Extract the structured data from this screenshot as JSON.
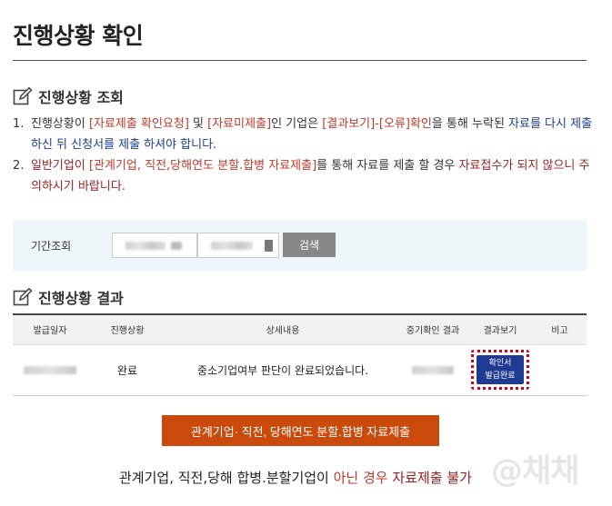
{
  "page_title": "진행상황 확인",
  "section_inquiry": {
    "title": "진행상황 조회",
    "icon": "edit-icon"
  },
  "notes": [
    {
      "num": "1.",
      "parts": [
        {
          "t": "진행상황이 ",
          "c": "plain"
        },
        {
          "t": "[자료제출 확인요청]",
          "c": "red"
        },
        {
          "t": " 및 ",
          "c": "plain"
        },
        {
          "t": "[자료미제출]",
          "c": "red"
        },
        {
          "t": "인 기업은 ",
          "c": "plain"
        },
        {
          "t": "[결과보기]-[오류]확인",
          "c": "red"
        },
        {
          "t": "을 통해 누락된 ",
          "c": "plain"
        },
        {
          "t": "자료를 다시 제출 하신 뒤 신청서를 제출 하셔야 합니다.",
          "c": "blue"
        }
      ]
    },
    {
      "num": "2.",
      "parts": [
        {
          "t": "일반기업이 ",
          "c": "dred"
        },
        {
          "t": "[관계기업, 직전,당해연도 분할.합병 자료제출]",
          "c": "red"
        },
        {
          "t": "를 통해 자료를 제출 할 경우 ",
          "c": "plain"
        },
        {
          "t": "자료접수가 되지 않으니 주의하시기 바랍니다.",
          "c": "dred"
        }
      ]
    }
  ],
  "search": {
    "label": "기간조회",
    "button_label": "검색"
  },
  "section_result": {
    "title": "진행상황 결과",
    "icon": "edit-icon"
  },
  "table": {
    "headers": [
      "발급일자",
      "진행상황",
      "상세내용",
      "중기확인 결과",
      "결과보기",
      "비고"
    ],
    "row": {
      "status": "완료",
      "detail": "중소기업여부 판단이 완료되었습니다.",
      "confirm_line1": "확인서",
      "confirm_line2": "발급완료",
      "remark": ""
    }
  },
  "submit_button": "관계기업· 직전, 당해연도 분할.합병 자료제출",
  "bottom_note": {
    "plain": "관계기업, 직전,당해 합병.분할기업이 ",
    "red": "아닌 경우",
    "dark": " 자료제출 불가"
  },
  "watermark": "@채채",
  "colors": {
    "accent_red": "#c0392b",
    "accent_blue": "#1a3d8f",
    "submit_orange": "#c94a0a",
    "confirm_blue": "#1f3a93"
  }
}
